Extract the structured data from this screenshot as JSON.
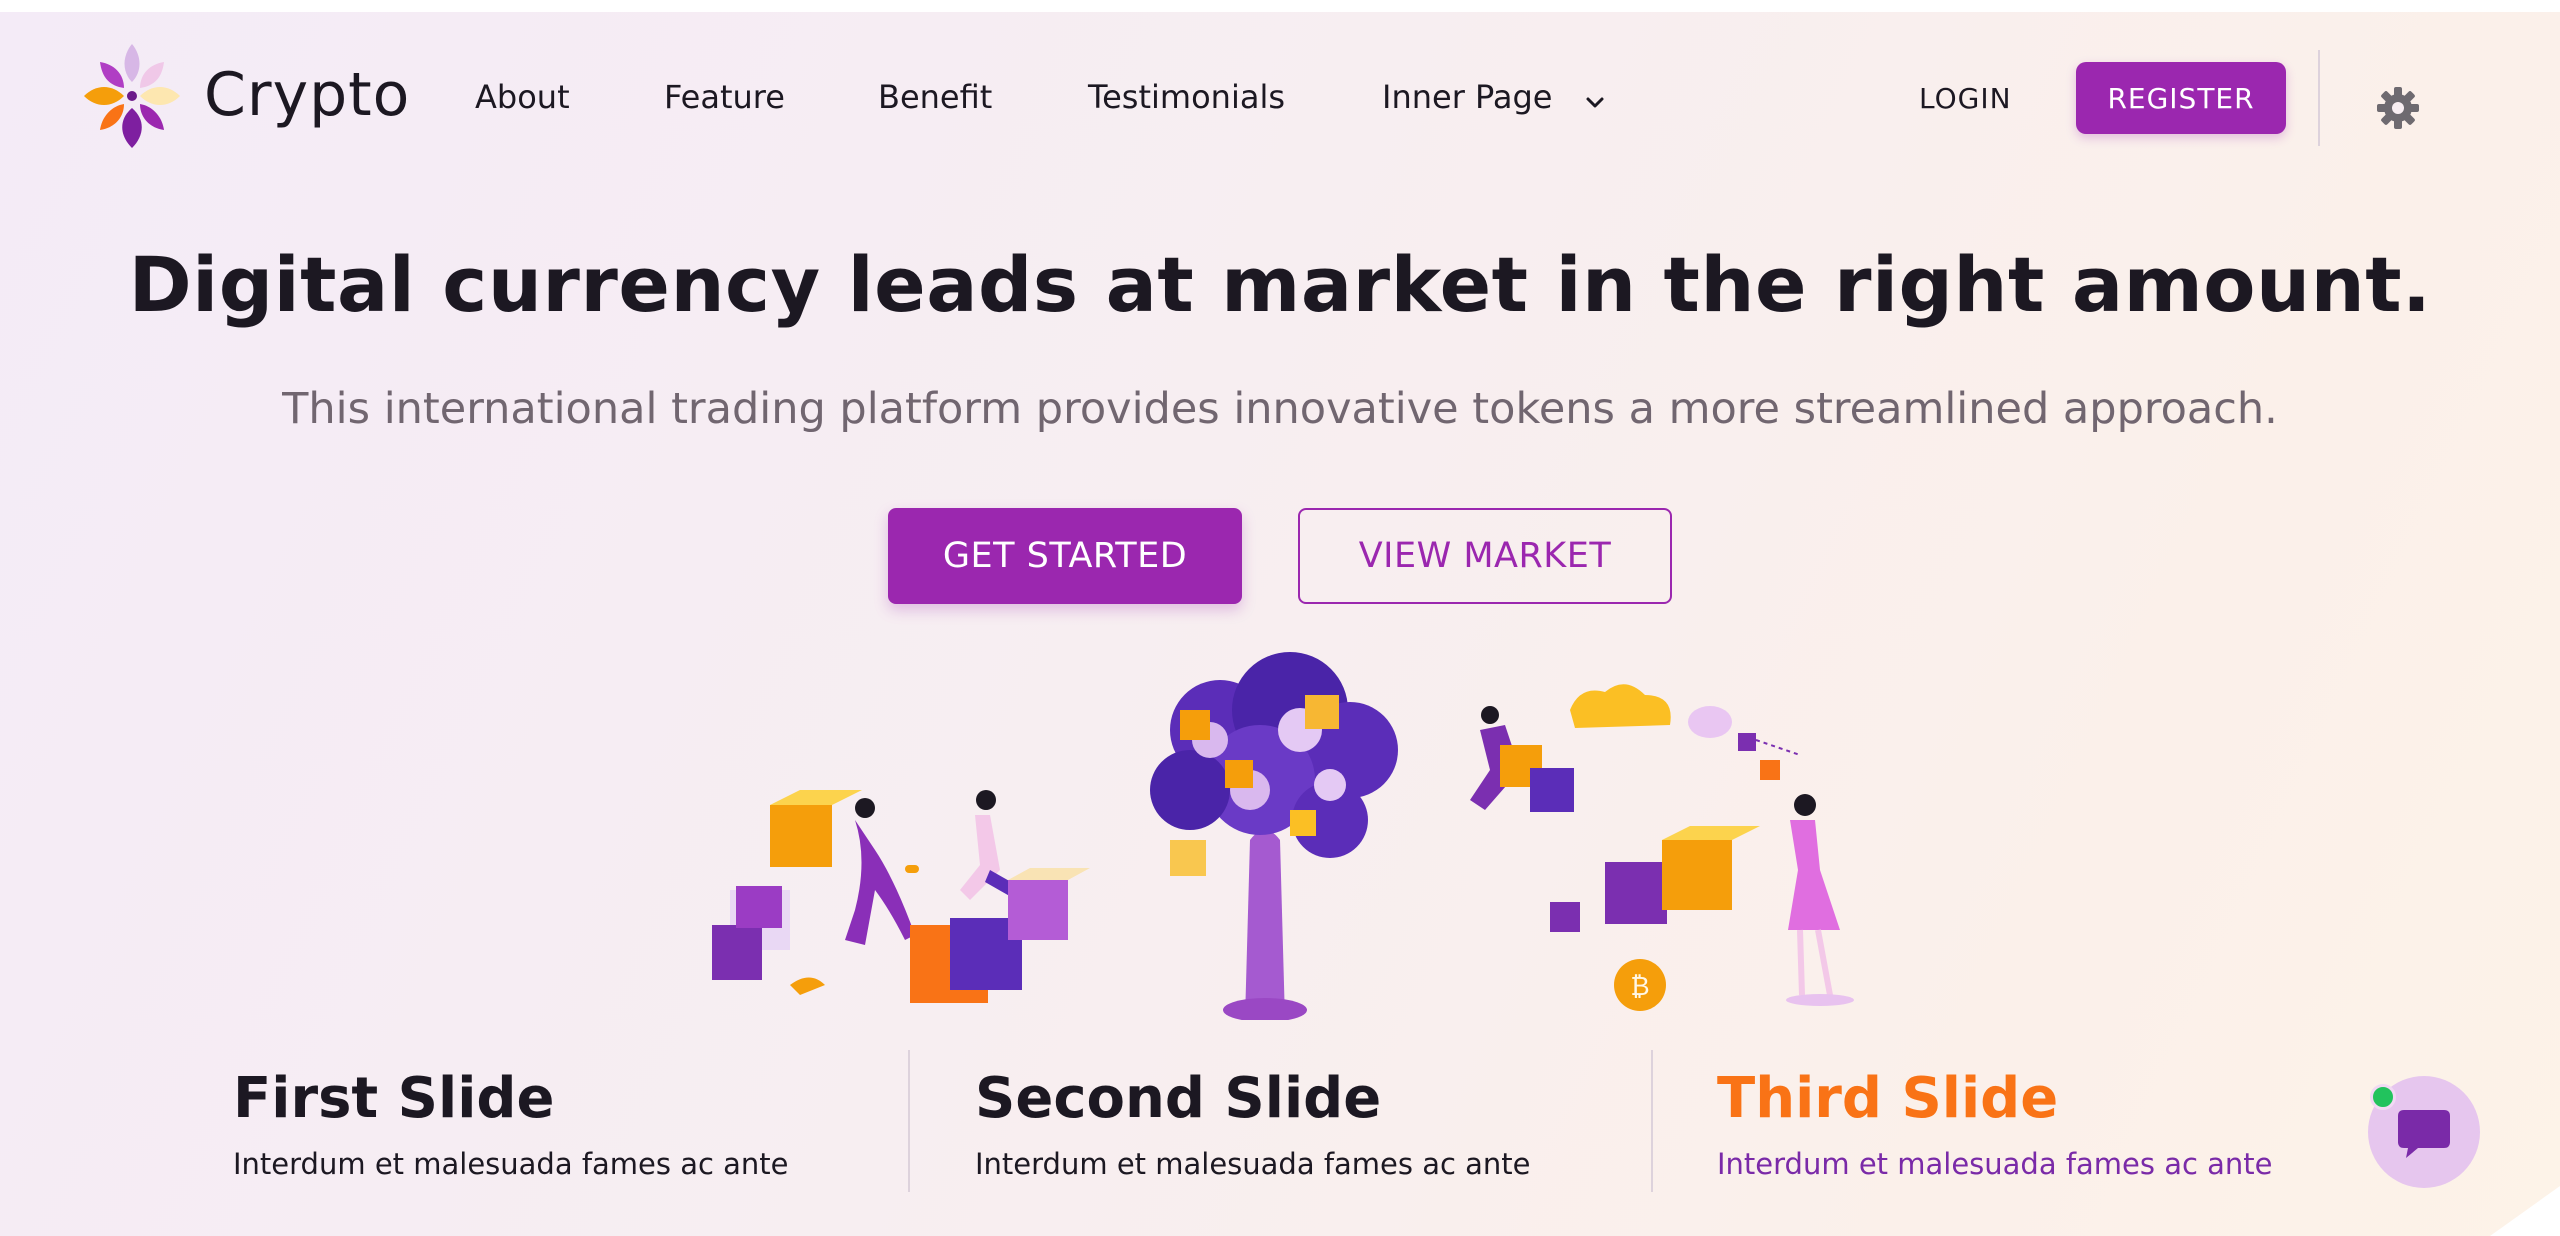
{
  "header": {
    "brand": "Crypto",
    "nav": [
      "About",
      "Feature",
      "Benefit",
      "Testimonials",
      "Inner Page"
    ],
    "login": "LOGIN",
    "register": "REGISTER"
  },
  "hero": {
    "headline": "Digital currency leads at market in the right amount.",
    "subline": "This international trading platform provides innovative tokens a more streamlined approach.",
    "primary_button": "GET STARTED",
    "secondary_button": "VIEW MARKET"
  },
  "slides": [
    {
      "title": "First Slide",
      "text": "Interdum et malesuada fames ac ante"
    },
    {
      "title": "Second Slide",
      "text": "Interdum et malesuada fames ac ante"
    },
    {
      "title": "Third Slide",
      "text": "Interdum et malesuada fames ac ante"
    }
  ],
  "icons": {
    "logo": "crypto-flower-logo",
    "inner_page_dropdown": "chevron-down-icon",
    "settings": "gear-icon",
    "chat": "chat-bubble-icon"
  },
  "colors": {
    "accent": "#9b27af",
    "active_slide_title": "#f97316",
    "active_slide_text": "#7a2aa8",
    "online_dot": "#22c35d"
  }
}
